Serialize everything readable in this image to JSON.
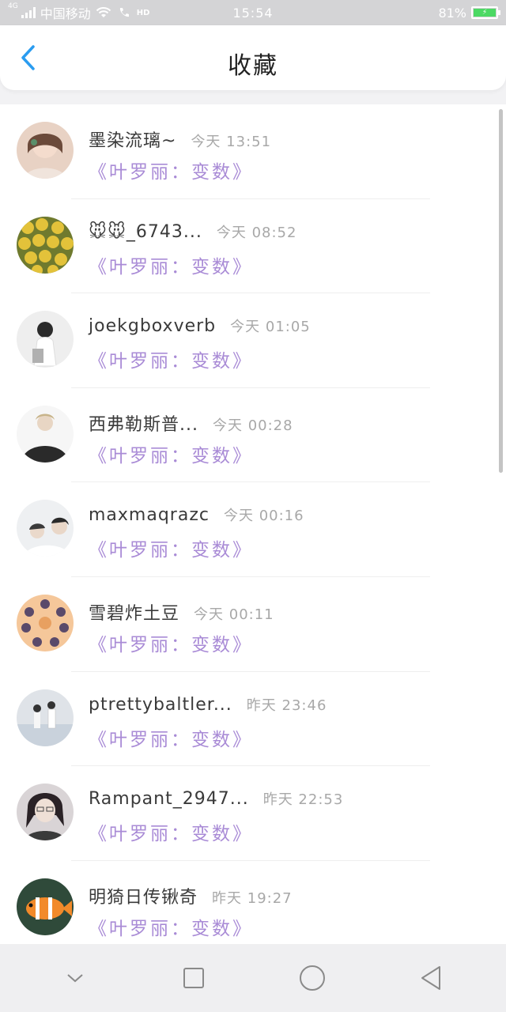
{
  "status_bar": {
    "network_small": "4G",
    "carrier": "中国移动",
    "hd": "HD",
    "time": "15:54",
    "battery_percent": "81%",
    "battery_level": 0.81
  },
  "header": {
    "title": "收藏",
    "accent_color": "#2a9cf0"
  },
  "items": [
    {
      "username": "墨染流璃~",
      "timestamp": "今天 13:51",
      "story": "《叶罗丽：变数》"
    },
    {
      "username": "🐭🐭_6743...",
      "timestamp": "今天 08:52",
      "story": "《叶罗丽：变数》"
    },
    {
      "username": "joekgboxverb",
      "timestamp": "今天 01:05",
      "story": "《叶罗丽：变数》"
    },
    {
      "username": "西弗勒斯普...",
      "timestamp": "今天 00:28",
      "story": "《叶罗丽：变数》"
    },
    {
      "username": "maxmaqrazc",
      "timestamp": "今天 00:16",
      "story": "《叶罗丽：变数》"
    },
    {
      "username": "雪碧炸土豆",
      "timestamp": "今天 00:11",
      "story": "《叶罗丽：变数》"
    },
    {
      "username": "ptrettybaltler...",
      "timestamp": "昨天 23:46",
      "story": "《叶罗丽：变数》"
    },
    {
      "username": "Rampant_2947...",
      "timestamp": "昨天 22:53",
      "story": "《叶罗丽：变数》"
    },
    {
      "username": "明猗日传锹奇",
      "timestamp": "昨天 19:27",
      "story": "《叶罗丽：变数》"
    }
  ],
  "colors": {
    "story_link": "#a98bd6",
    "timestamp": "#a8a8a8",
    "back_arrow": "#2a9cf0"
  },
  "nav_icons": [
    "chevron-down-icon",
    "square-icon",
    "circle-icon",
    "triangle-back-icon"
  ]
}
